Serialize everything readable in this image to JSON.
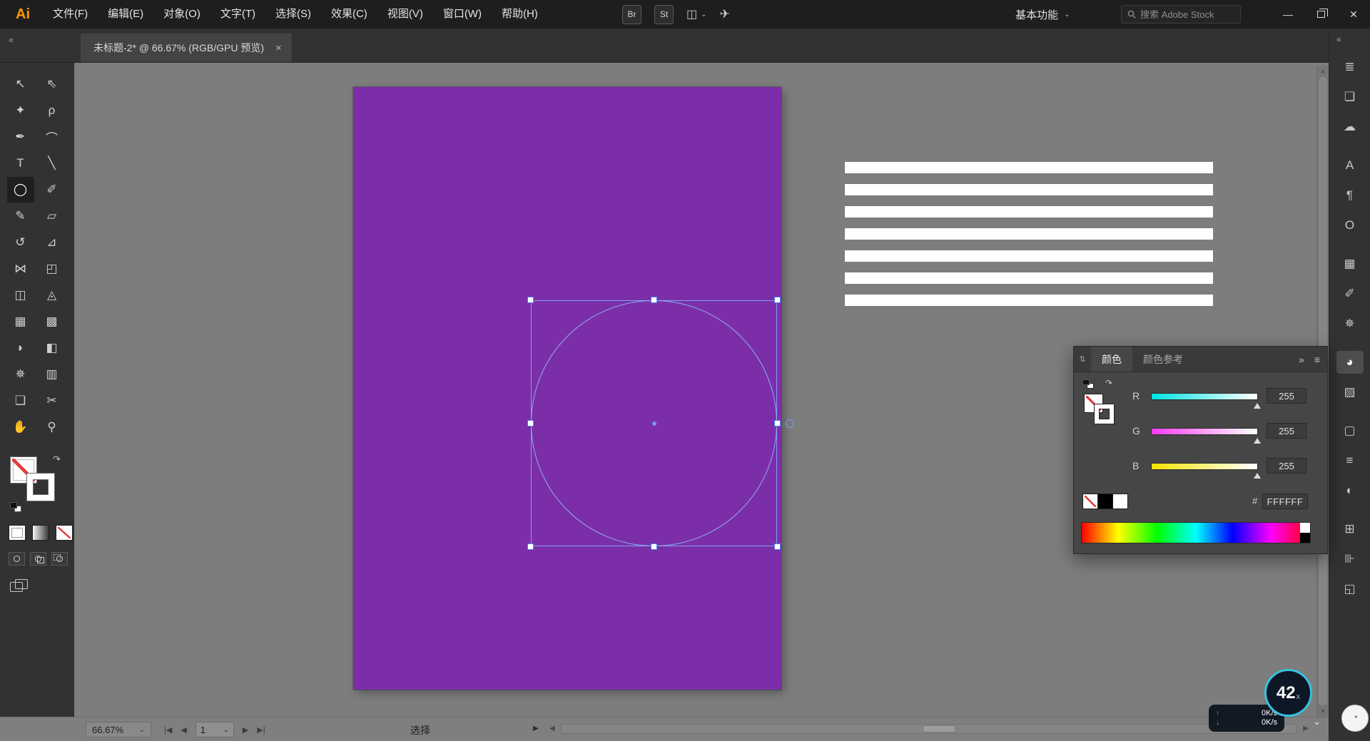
{
  "colors": {
    "menu_bar_bg": "#1e1e1e",
    "panel_bg": "#323232",
    "color_panel_bg": "#464646",
    "canvas_bg": "#7d7d7d",
    "artboard_purple": "#7c2ea8",
    "selection_blue": "#5d8de8",
    "badge_ring_cyan": "#35c3df",
    "logo_orange": "#ff9a00",
    "text_bar_white": "#ffffff"
  },
  "menu_bar": {
    "logo": "Ai",
    "items": [
      {
        "name": "menu-file",
        "label": "文件(F)"
      },
      {
        "name": "menu-edit",
        "label": "编辑(E)"
      },
      {
        "name": "menu-object",
        "label": "对象(O)"
      },
      {
        "name": "menu-type",
        "label": "文字(T)"
      },
      {
        "name": "menu-select",
        "label": "选择(S)"
      },
      {
        "name": "menu-effect",
        "label": "效果(C)"
      },
      {
        "name": "menu-view",
        "label": "视图(V)"
      },
      {
        "name": "menu-window",
        "label": "窗口(W)"
      },
      {
        "name": "menu-help",
        "label": "帮助(H)"
      }
    ],
    "bridge_label": "Br",
    "stock_label": "St",
    "arrange_icon": "◫",
    "arrange_chevron": "⌄",
    "share_icon": "✈",
    "workspace_label": "基本功能",
    "workspace_chevron": "⌄",
    "search_placeholder": "搜索 Adobe Stock"
  },
  "window_controls": {
    "minimize": "—",
    "restore_icon": "overlapping-squares",
    "close": "✕"
  },
  "document_tab": {
    "collapse": "«",
    "title": "未标题-2* @ 66.67% (RGB/GPU 预览)",
    "close": "×"
  },
  "tools": [
    {
      "name": "selection-tool",
      "glyph": "↖"
    },
    {
      "name": "direct-selection-tool",
      "glyph": "⇖"
    },
    {
      "name": "magic-wand-tool",
      "glyph": "✦"
    },
    {
      "name": "lasso-tool",
      "glyph": "ρ"
    },
    {
      "name": "pen-tool",
      "glyph": "✒"
    },
    {
      "name": "curvature-tool",
      "glyph": "⌒"
    },
    {
      "name": "type-tool",
      "glyph": "T"
    },
    {
      "name": "line-segment-tool",
      "glyph": "╲"
    },
    {
      "name": "ellipse-tool",
      "glyph": "◯",
      "active": true
    },
    {
      "name": "paintbrush-tool",
      "glyph": "✐"
    },
    {
      "name": "pencil-tool",
      "glyph": "✎"
    },
    {
      "name": "eraser-tool",
      "glyph": "▱"
    },
    {
      "name": "rotate-tool",
      "glyph": "↺"
    },
    {
      "name": "scale-tool",
      "glyph": "⊿"
    },
    {
      "name": "width-tool",
      "glyph": "⋈"
    },
    {
      "name": "free-transform-tool",
      "glyph": "◰"
    },
    {
      "name": "shape-builder-tool",
      "glyph": "◫"
    },
    {
      "name": "perspective-grid-tool",
      "glyph": "◬"
    },
    {
      "name": "mesh-tool",
      "glyph": "▦"
    },
    {
      "name": "gradient-tool",
      "glyph": "▩"
    },
    {
      "name": "eyedropper-tool",
      "glyph": "◗"
    },
    {
      "name": "blend-tool",
      "glyph": "◧"
    },
    {
      "name": "symbol-sprayer-tool",
      "glyph": "✵"
    },
    {
      "name": "column-graph-tool",
      "glyph": "▥"
    },
    {
      "name": "artboard-tool",
      "glyph": "❏"
    },
    {
      "name": "slice-tool",
      "glyph": "✂"
    },
    {
      "name": "hand-tool",
      "glyph": "✋"
    },
    {
      "name": "zoom-tool",
      "glyph": "⚲"
    }
  ],
  "dock": {
    "expand": "«",
    "icons": [
      {
        "name": "properties-panel-icon",
        "glyph": "≣"
      },
      {
        "name": "layers-panel-icon",
        "glyph": "❏"
      },
      {
        "name": "libraries-panel-icon",
        "glyph": "☁"
      },
      {
        "name": "character-panel-icon",
        "glyph": "A",
        "group": true
      },
      {
        "name": "paragraph-panel-icon",
        "glyph": "¶"
      },
      {
        "name": "opentype-panel-icon",
        "glyph": "O"
      },
      {
        "name": "swatches-panel-icon",
        "glyph": "▦",
        "group": true
      },
      {
        "name": "brushes-panel-icon",
        "glyph": "✐"
      },
      {
        "name": "symbols-panel-icon",
        "glyph": "✵"
      },
      {
        "name": "color-panel-icon",
        "glyph": "◕",
        "active": true,
        "group": true
      },
      {
        "name": "color-guide-panel-icon",
        "glyph": "▨"
      },
      {
        "name": "appearance-panel-icon",
        "glyph": "▢",
        "group": true
      },
      {
        "name": "stroke-panel-icon",
        "glyph": "≡"
      },
      {
        "name": "transparency-panel-icon",
        "glyph": "◐"
      },
      {
        "name": "transform-panel-icon",
        "glyph": "⊞",
        "group": true
      },
      {
        "name": "align-panel-icon",
        "glyph": "⊪"
      },
      {
        "name": "pathfinder-panel-icon",
        "glyph": "◱"
      }
    ]
  },
  "color_panel": {
    "collapse_icon": "⇅",
    "tabs": [
      {
        "name": "tab-color",
        "label": "颜色",
        "active": true
      },
      {
        "name": "tab-color-guide",
        "label": "颜色参考"
      }
    ],
    "icons_collapse": "»",
    "menu_icon": "≡",
    "swap_icon": "↷",
    "sliders": [
      {
        "name": "slider-red",
        "label": "R",
        "value": "255"
      },
      {
        "name": "slider-green",
        "label": "G",
        "value": "255"
      },
      {
        "name": "slider-blue",
        "label": "B",
        "value": "255"
      }
    ],
    "hex_label": "#",
    "hex_value": "FFFFFF"
  },
  "canvas": {
    "white_bars": [
      {
        "name": "text-line-bar"
      },
      {
        "name": "text-line-bar"
      },
      {
        "name": "text-line-bar"
      },
      {
        "name": "text-line-bar"
      },
      {
        "name": "text-line-bar"
      },
      {
        "name": "text-line-bar"
      },
      {
        "name": "text-line-bar"
      }
    ]
  },
  "status_bar": {
    "zoom_value": "66.67%",
    "zoom_chevron": "⌄",
    "first_icon": "|◀",
    "prev_icon": "◀",
    "artboard_number": "1",
    "artboard_chevron": "⌄",
    "next_icon": "▶",
    "last_icon": "▶|",
    "status_label": "选择",
    "flyout_icon": "▶",
    "scroll_left_icon": "◀",
    "scroll_right_icon": "▶",
    "vscroll_up_icon": "▲",
    "vscroll_down_icon": "▼"
  },
  "overlays": {
    "up_arrow": "↑",
    "up_value": "0K/s",
    "down_arrow": "↓",
    "down_value": "0K/s",
    "badge_value": "42",
    "badge_suffix": "x",
    "collapse_icon": "⌄",
    "float_ball_icon": "◔"
  }
}
